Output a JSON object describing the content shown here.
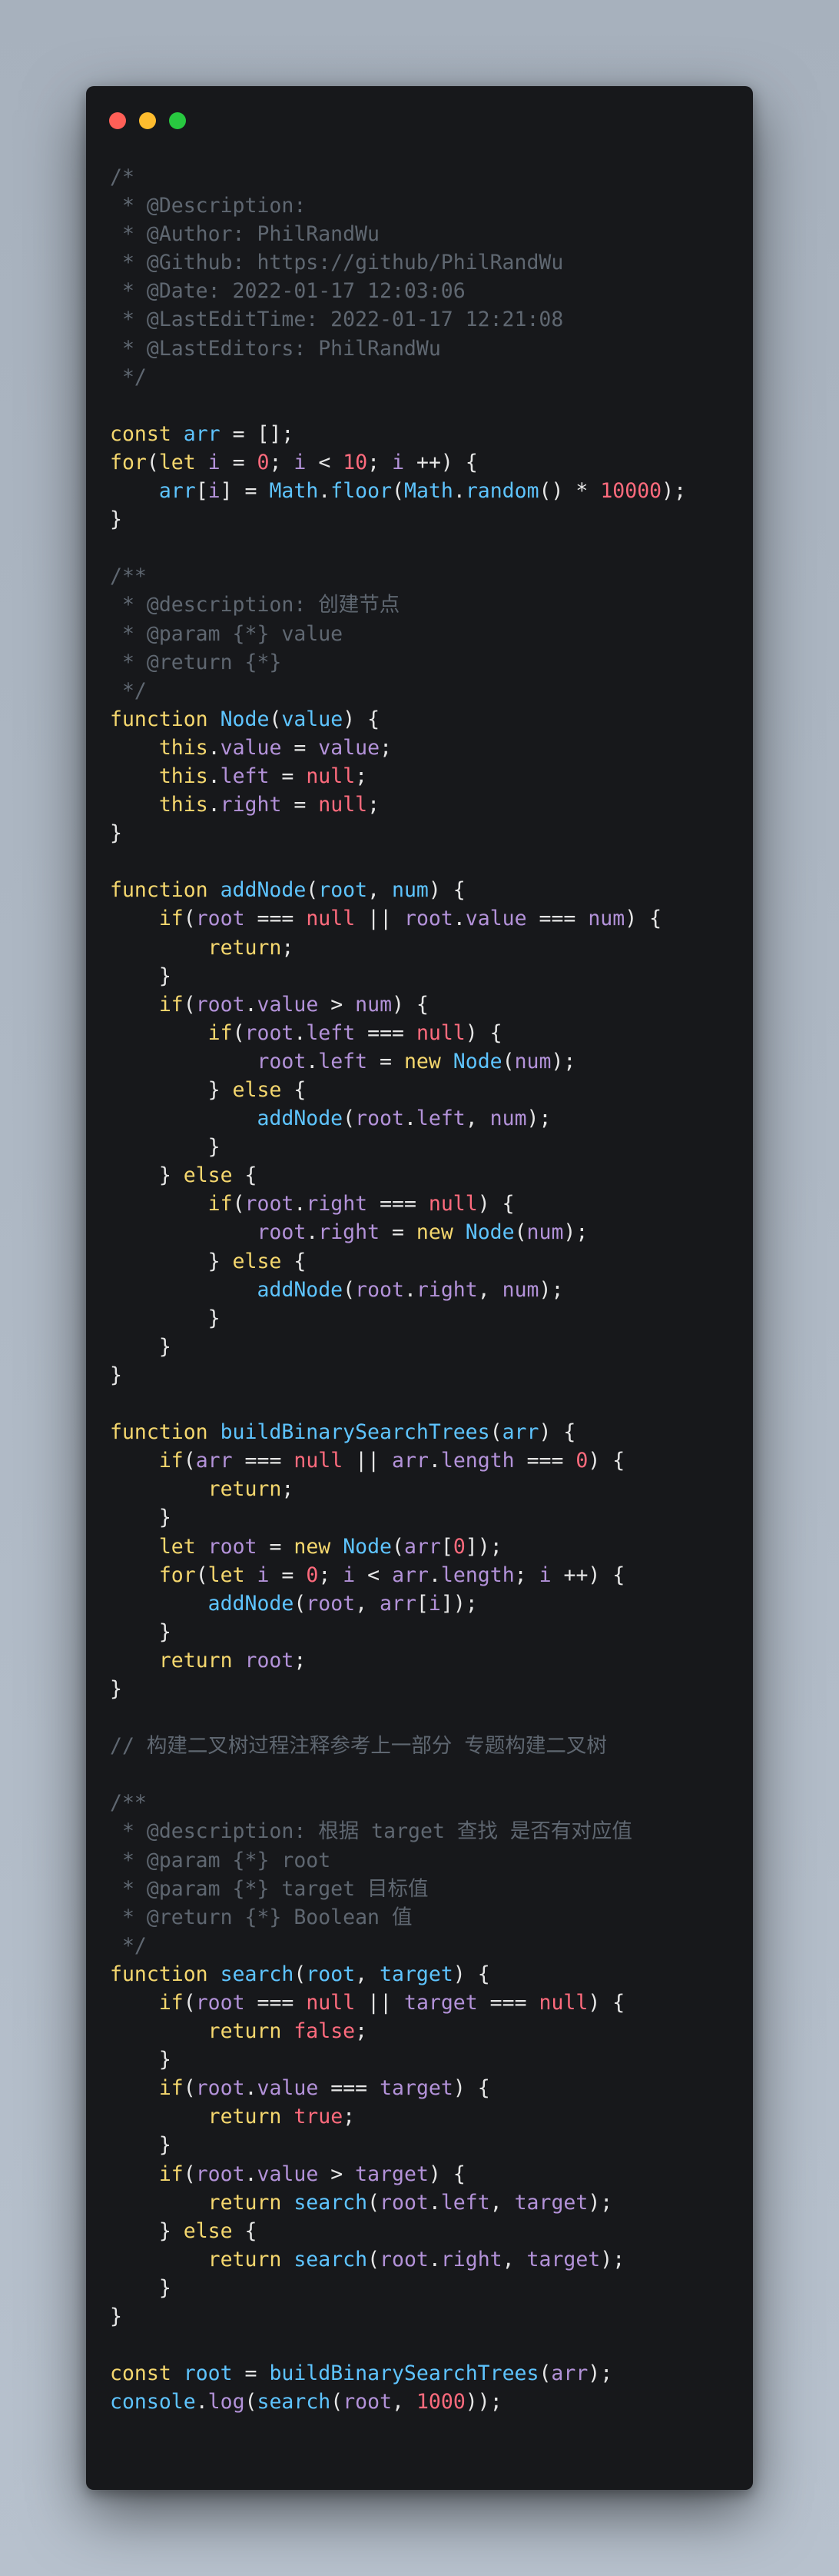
{
  "colors": {
    "background_top": "#a7b1bd",
    "window_bg": "#17181b",
    "dot_close": "#ff5f57",
    "dot_minimize": "#febc2e",
    "dot_maximize": "#28c840"
  },
  "window_controls": [
    {
      "name": "close",
      "icon": "close-dot-icon",
      "color": "#ff5f57"
    },
    {
      "name": "minimize",
      "icon": "minimize-dot-icon",
      "color": "#febc2e"
    },
    {
      "name": "maximize",
      "icon": "maximize-dot-icon",
      "color": "#28c840"
    }
  ],
  "token_colors": {
    "p": "#e6e6e6",
    "k": "#f5d76e",
    "f": "#5ec4ff",
    "v": "#b392d9",
    "n": "#ff6b7d",
    "c": "#5f6771",
    "o": "#e6e6e6"
  },
  "code_lines": [
    [
      [
        "c",
        "/*"
      ]
    ],
    [
      [
        "c",
        " * @Description: "
      ]
    ],
    [
      [
        "c",
        " * @Author: PhilRandWu"
      ]
    ],
    [
      [
        "c",
        " * @Github: https://github/PhilRandWu"
      ]
    ],
    [
      [
        "c",
        " * @Date: 2022-01-17 12:03:06"
      ]
    ],
    [
      [
        "c",
        " * @LastEditTime: 2022-01-17 12:21:08"
      ]
    ],
    [
      [
        "c",
        " * @LastEditors: PhilRandWu"
      ]
    ],
    [
      [
        "c",
        " */"
      ]
    ],
    [],
    [
      [
        "k",
        "const "
      ],
      [
        "f",
        "arr"
      ],
      [
        "p",
        " = [];"
      ]
    ],
    [
      [
        "k",
        "for"
      ],
      [
        "p",
        "("
      ],
      [
        "k",
        "let "
      ],
      [
        "v",
        "i"
      ],
      [
        "p",
        " = "
      ],
      [
        "n",
        "0"
      ],
      [
        "p",
        "; "
      ],
      [
        "v",
        "i"
      ],
      [
        "p",
        " < "
      ],
      [
        "n",
        "10"
      ],
      [
        "p",
        "; "
      ],
      [
        "v",
        "i"
      ],
      [
        "p",
        " ++) {"
      ]
    ],
    [
      [
        "p",
        "    "
      ],
      [
        "f",
        "arr"
      ],
      [
        "p",
        "["
      ],
      [
        "v",
        "i"
      ],
      [
        "p",
        "] = "
      ],
      [
        "f",
        "Math"
      ],
      [
        "p",
        "."
      ],
      [
        "f",
        "floor"
      ],
      [
        "p",
        "("
      ],
      [
        "f",
        "Math"
      ],
      [
        "p",
        "."
      ],
      [
        "f",
        "random"
      ],
      [
        "p",
        "() * "
      ],
      [
        "n",
        "10000"
      ],
      [
        "p",
        ");"
      ]
    ],
    [
      [
        "p",
        "}"
      ]
    ],
    [],
    [
      [
        "c",
        "/**"
      ]
    ],
    [
      [
        "c",
        " * @description: 创建节点"
      ]
    ],
    [
      [
        "c",
        " * @param {*} value"
      ]
    ],
    [
      [
        "c",
        " * @return {*}"
      ]
    ],
    [
      [
        "c",
        " */"
      ]
    ],
    [
      [
        "k",
        "function "
      ],
      [
        "f",
        "Node"
      ],
      [
        "p",
        "("
      ],
      [
        "f",
        "value"
      ],
      [
        "p",
        ") {"
      ]
    ],
    [
      [
        "p",
        "    "
      ],
      [
        "k",
        "this"
      ],
      [
        "p",
        "."
      ],
      [
        "v",
        "value"
      ],
      [
        "p",
        " = "
      ],
      [
        "v",
        "value"
      ],
      [
        "p",
        ";"
      ]
    ],
    [
      [
        "p",
        "    "
      ],
      [
        "k",
        "this"
      ],
      [
        "p",
        "."
      ],
      [
        "v",
        "left"
      ],
      [
        "p",
        " = "
      ],
      [
        "n",
        "null"
      ],
      [
        "p",
        ";"
      ]
    ],
    [
      [
        "p",
        "    "
      ],
      [
        "k",
        "this"
      ],
      [
        "p",
        "."
      ],
      [
        "v",
        "right"
      ],
      [
        "p",
        " = "
      ],
      [
        "n",
        "null"
      ],
      [
        "p",
        ";"
      ]
    ],
    [
      [
        "p",
        "}"
      ]
    ],
    [],
    [
      [
        "k",
        "function "
      ],
      [
        "f",
        "addNode"
      ],
      [
        "p",
        "("
      ],
      [
        "f",
        "root"
      ],
      [
        "p",
        ", "
      ],
      [
        "f",
        "num"
      ],
      [
        "p",
        ") {"
      ]
    ],
    [
      [
        "p",
        "    "
      ],
      [
        "k",
        "if"
      ],
      [
        "p",
        "("
      ],
      [
        "v",
        "root"
      ],
      [
        "p",
        " === "
      ],
      [
        "n",
        "null"
      ],
      [
        "p",
        " || "
      ],
      [
        "v",
        "root"
      ],
      [
        "p",
        "."
      ],
      [
        "v",
        "value"
      ],
      [
        "p",
        " === "
      ],
      [
        "v",
        "num"
      ],
      [
        "p",
        ") {"
      ]
    ],
    [
      [
        "p",
        "        "
      ],
      [
        "k",
        "return"
      ],
      [
        "p",
        ";"
      ]
    ],
    [
      [
        "p",
        "    }"
      ]
    ],
    [
      [
        "p",
        "    "
      ],
      [
        "k",
        "if"
      ],
      [
        "p",
        "("
      ],
      [
        "v",
        "root"
      ],
      [
        "p",
        "."
      ],
      [
        "v",
        "value"
      ],
      [
        "p",
        " > "
      ],
      [
        "v",
        "num"
      ],
      [
        "p",
        ") {"
      ]
    ],
    [
      [
        "p",
        "        "
      ],
      [
        "k",
        "if"
      ],
      [
        "p",
        "("
      ],
      [
        "v",
        "root"
      ],
      [
        "p",
        "."
      ],
      [
        "v",
        "left"
      ],
      [
        "p",
        " === "
      ],
      [
        "n",
        "null"
      ],
      [
        "p",
        ") {"
      ]
    ],
    [
      [
        "p",
        "            "
      ],
      [
        "v",
        "root"
      ],
      [
        "p",
        "."
      ],
      [
        "v",
        "left"
      ],
      [
        "p",
        " = "
      ],
      [
        "k",
        "new "
      ],
      [
        "f",
        "Node"
      ],
      [
        "p",
        "("
      ],
      [
        "v",
        "num"
      ],
      [
        "p",
        ");"
      ]
    ],
    [
      [
        "p",
        "        } "
      ],
      [
        "k",
        "else"
      ],
      [
        "p",
        " {"
      ]
    ],
    [
      [
        "p",
        "            "
      ],
      [
        "f",
        "addNode"
      ],
      [
        "p",
        "("
      ],
      [
        "v",
        "root"
      ],
      [
        "p",
        "."
      ],
      [
        "v",
        "left"
      ],
      [
        "p",
        ", "
      ],
      [
        "v",
        "num"
      ],
      [
        "p",
        ");"
      ]
    ],
    [
      [
        "p",
        "        }"
      ]
    ],
    [
      [
        "p",
        "    } "
      ],
      [
        "k",
        "else"
      ],
      [
        "p",
        " {"
      ]
    ],
    [
      [
        "p",
        "        "
      ],
      [
        "k",
        "if"
      ],
      [
        "p",
        "("
      ],
      [
        "v",
        "root"
      ],
      [
        "p",
        "."
      ],
      [
        "v",
        "right"
      ],
      [
        "p",
        " === "
      ],
      [
        "n",
        "null"
      ],
      [
        "p",
        ") {"
      ]
    ],
    [
      [
        "p",
        "            "
      ],
      [
        "v",
        "root"
      ],
      [
        "p",
        "."
      ],
      [
        "v",
        "right"
      ],
      [
        "p",
        " = "
      ],
      [
        "k",
        "new "
      ],
      [
        "f",
        "Node"
      ],
      [
        "p",
        "("
      ],
      [
        "v",
        "num"
      ],
      [
        "p",
        ");"
      ]
    ],
    [
      [
        "p",
        "        } "
      ],
      [
        "k",
        "else"
      ],
      [
        "p",
        " {"
      ]
    ],
    [
      [
        "p",
        "            "
      ],
      [
        "f",
        "addNode"
      ],
      [
        "p",
        "("
      ],
      [
        "v",
        "root"
      ],
      [
        "p",
        "."
      ],
      [
        "v",
        "right"
      ],
      [
        "p",
        ", "
      ],
      [
        "v",
        "num"
      ],
      [
        "p",
        ");"
      ]
    ],
    [
      [
        "p",
        "        }"
      ]
    ],
    [
      [
        "p",
        "    }"
      ]
    ],
    [
      [
        "p",
        "}"
      ]
    ],
    [],
    [
      [
        "k",
        "function "
      ],
      [
        "f",
        "buildBinarySearchTrees"
      ],
      [
        "p",
        "("
      ],
      [
        "f",
        "arr"
      ],
      [
        "p",
        ") {"
      ]
    ],
    [
      [
        "p",
        "    "
      ],
      [
        "k",
        "if"
      ],
      [
        "p",
        "("
      ],
      [
        "v",
        "arr"
      ],
      [
        "p",
        " === "
      ],
      [
        "n",
        "null"
      ],
      [
        "p",
        " || "
      ],
      [
        "v",
        "arr"
      ],
      [
        "p",
        "."
      ],
      [
        "v",
        "length"
      ],
      [
        "p",
        " === "
      ],
      [
        "n",
        "0"
      ],
      [
        "p",
        ") {"
      ]
    ],
    [
      [
        "p",
        "        "
      ],
      [
        "k",
        "return"
      ],
      [
        "p",
        ";"
      ]
    ],
    [
      [
        "p",
        "    }"
      ]
    ],
    [
      [
        "p",
        "    "
      ],
      [
        "k",
        "let "
      ],
      [
        "v",
        "root"
      ],
      [
        "p",
        " = "
      ],
      [
        "k",
        "new "
      ],
      [
        "f",
        "Node"
      ],
      [
        "p",
        "("
      ],
      [
        "v",
        "arr"
      ],
      [
        "p",
        "["
      ],
      [
        "n",
        "0"
      ],
      [
        "p",
        "]);"
      ]
    ],
    [
      [
        "p",
        "    "
      ],
      [
        "k",
        "for"
      ],
      [
        "p",
        "("
      ],
      [
        "k",
        "let "
      ],
      [
        "v",
        "i"
      ],
      [
        "p",
        " = "
      ],
      [
        "n",
        "0"
      ],
      [
        "p",
        "; "
      ],
      [
        "v",
        "i"
      ],
      [
        "p",
        " < "
      ],
      [
        "v",
        "arr"
      ],
      [
        "p",
        "."
      ],
      [
        "v",
        "length"
      ],
      [
        "p",
        "; "
      ],
      [
        "v",
        "i"
      ],
      [
        "p",
        " ++) {"
      ]
    ],
    [
      [
        "p",
        "        "
      ],
      [
        "f",
        "addNode"
      ],
      [
        "p",
        "("
      ],
      [
        "v",
        "root"
      ],
      [
        "p",
        ", "
      ],
      [
        "v",
        "arr"
      ],
      [
        "p",
        "["
      ],
      [
        "v",
        "i"
      ],
      [
        "p",
        "]);"
      ]
    ],
    [
      [
        "p",
        "    }"
      ]
    ],
    [
      [
        "p",
        "    "
      ],
      [
        "k",
        "return "
      ],
      [
        "v",
        "root"
      ],
      [
        "p",
        ";"
      ]
    ],
    [
      [
        "p",
        "}"
      ]
    ],
    [],
    [
      [
        "c",
        "// 构建二叉树过程注释参考上一部分 专题构建二叉树"
      ]
    ],
    [],
    [
      [
        "c",
        "/**"
      ]
    ],
    [
      [
        "c",
        " * @description: 根据 target 查找 是否有对应值"
      ]
    ],
    [
      [
        "c",
        " * @param {*} root"
      ]
    ],
    [
      [
        "c",
        " * @param {*} target 目标值"
      ]
    ],
    [
      [
        "c",
        " * @return {*} Boolean 值"
      ]
    ],
    [
      [
        "c",
        " */"
      ]
    ],
    [
      [
        "k",
        "function "
      ],
      [
        "f",
        "search"
      ],
      [
        "p",
        "("
      ],
      [
        "f",
        "root"
      ],
      [
        "p",
        ", "
      ],
      [
        "f",
        "target"
      ],
      [
        "p",
        ") {"
      ]
    ],
    [
      [
        "p",
        "    "
      ],
      [
        "k",
        "if"
      ],
      [
        "p",
        "("
      ],
      [
        "v",
        "root"
      ],
      [
        "p",
        " === "
      ],
      [
        "n",
        "null"
      ],
      [
        "p",
        " || "
      ],
      [
        "v",
        "target"
      ],
      [
        "p",
        " === "
      ],
      [
        "n",
        "null"
      ],
      [
        "p",
        ") {"
      ]
    ],
    [
      [
        "p",
        "        "
      ],
      [
        "k",
        "return "
      ],
      [
        "n",
        "false"
      ],
      [
        "p",
        ";"
      ]
    ],
    [
      [
        "p",
        "    }"
      ]
    ],
    [
      [
        "p",
        "    "
      ],
      [
        "k",
        "if"
      ],
      [
        "p",
        "("
      ],
      [
        "v",
        "root"
      ],
      [
        "p",
        "."
      ],
      [
        "v",
        "value"
      ],
      [
        "p",
        " === "
      ],
      [
        "v",
        "target"
      ],
      [
        "p",
        ") {"
      ]
    ],
    [
      [
        "p",
        "        "
      ],
      [
        "k",
        "return "
      ],
      [
        "n",
        "true"
      ],
      [
        "p",
        ";"
      ]
    ],
    [
      [
        "p",
        "    }"
      ]
    ],
    [
      [
        "p",
        "    "
      ],
      [
        "k",
        "if"
      ],
      [
        "p",
        "("
      ],
      [
        "v",
        "root"
      ],
      [
        "p",
        "."
      ],
      [
        "v",
        "value"
      ],
      [
        "p",
        " > "
      ],
      [
        "v",
        "target"
      ],
      [
        "p",
        ") {"
      ]
    ],
    [
      [
        "p",
        "        "
      ],
      [
        "k",
        "return "
      ],
      [
        "f",
        "search"
      ],
      [
        "p",
        "("
      ],
      [
        "v",
        "root"
      ],
      [
        "p",
        "."
      ],
      [
        "v",
        "left"
      ],
      [
        "p",
        ", "
      ],
      [
        "v",
        "target"
      ],
      [
        "p",
        ");"
      ]
    ],
    [
      [
        "p",
        "    } "
      ],
      [
        "k",
        "else"
      ],
      [
        "p",
        " {"
      ]
    ],
    [
      [
        "p",
        "        "
      ],
      [
        "k",
        "return "
      ],
      [
        "f",
        "search"
      ],
      [
        "p",
        "("
      ],
      [
        "v",
        "root"
      ],
      [
        "p",
        "."
      ],
      [
        "v",
        "right"
      ],
      [
        "p",
        ", "
      ],
      [
        "v",
        "target"
      ],
      [
        "p",
        ");"
      ]
    ],
    [
      [
        "p",
        "    }"
      ]
    ],
    [
      [
        "p",
        "}"
      ]
    ],
    [],
    [
      [
        "k",
        "const "
      ],
      [
        "f",
        "root"
      ],
      [
        "p",
        " = "
      ],
      [
        "f",
        "buildBinarySearchTrees"
      ],
      [
        "p",
        "("
      ],
      [
        "v",
        "arr"
      ],
      [
        "p",
        ");"
      ]
    ],
    [
      [
        "f",
        "console"
      ],
      [
        "p",
        "."
      ],
      [
        "v",
        "log"
      ],
      [
        "p",
        "("
      ],
      [
        "f",
        "search"
      ],
      [
        "p",
        "("
      ],
      [
        "v",
        "root"
      ],
      [
        "p",
        ", "
      ],
      [
        "n",
        "1000"
      ],
      [
        "p",
        "));"
      ]
    ]
  ]
}
